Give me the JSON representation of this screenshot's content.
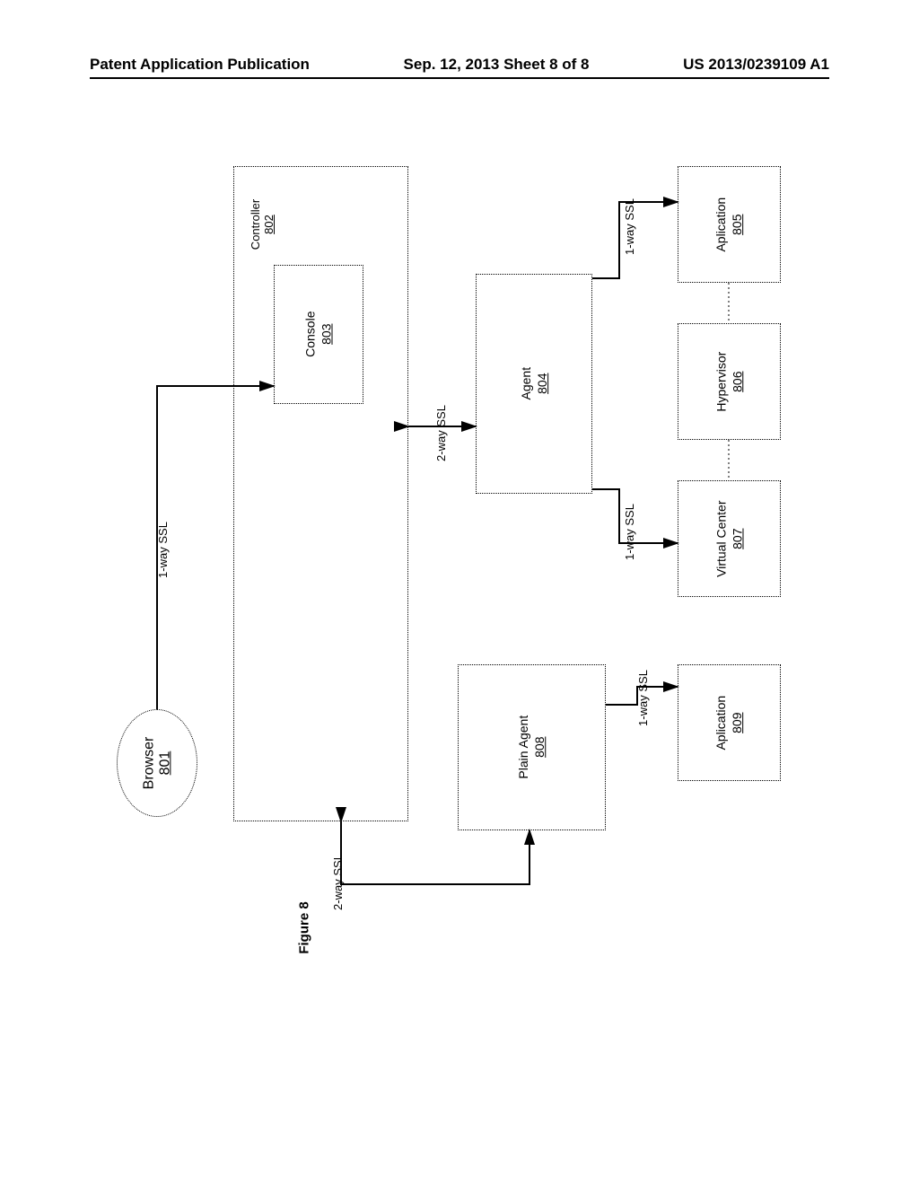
{
  "header": {
    "left": "Patent Application Publication",
    "center": "Sep. 12, 2013  Sheet 8 of 8",
    "right": "US 2013/0239109 A1"
  },
  "nodes": {
    "browser": {
      "label": "Browser",
      "num": "801"
    },
    "controller": {
      "label": "Controller",
      "num": "802"
    },
    "console": {
      "label": "Console",
      "num": "803"
    },
    "agent": {
      "label": "Agent",
      "num": "804"
    },
    "application1": {
      "label": "Aplication",
      "num": "805"
    },
    "hypervisor": {
      "label": "Hypervisor",
      "num": "806"
    },
    "virtualcenter": {
      "label": "Virtual Center",
      "num": "807"
    },
    "plainagent": {
      "label": "Plain Agent",
      "num": "808"
    },
    "application2": {
      "label": "Aplication",
      "num": "809"
    }
  },
  "edges": {
    "browser_console": "1-way SSL",
    "controller_agent": "2-way SSL",
    "agent_application1": "1-way SSL",
    "agent_virtualcenter": "1-way SSL",
    "controller_plainagent": "2-way SSL",
    "plainagent_application2": "1-way SSL"
  },
  "figure_label": "Figure 8"
}
